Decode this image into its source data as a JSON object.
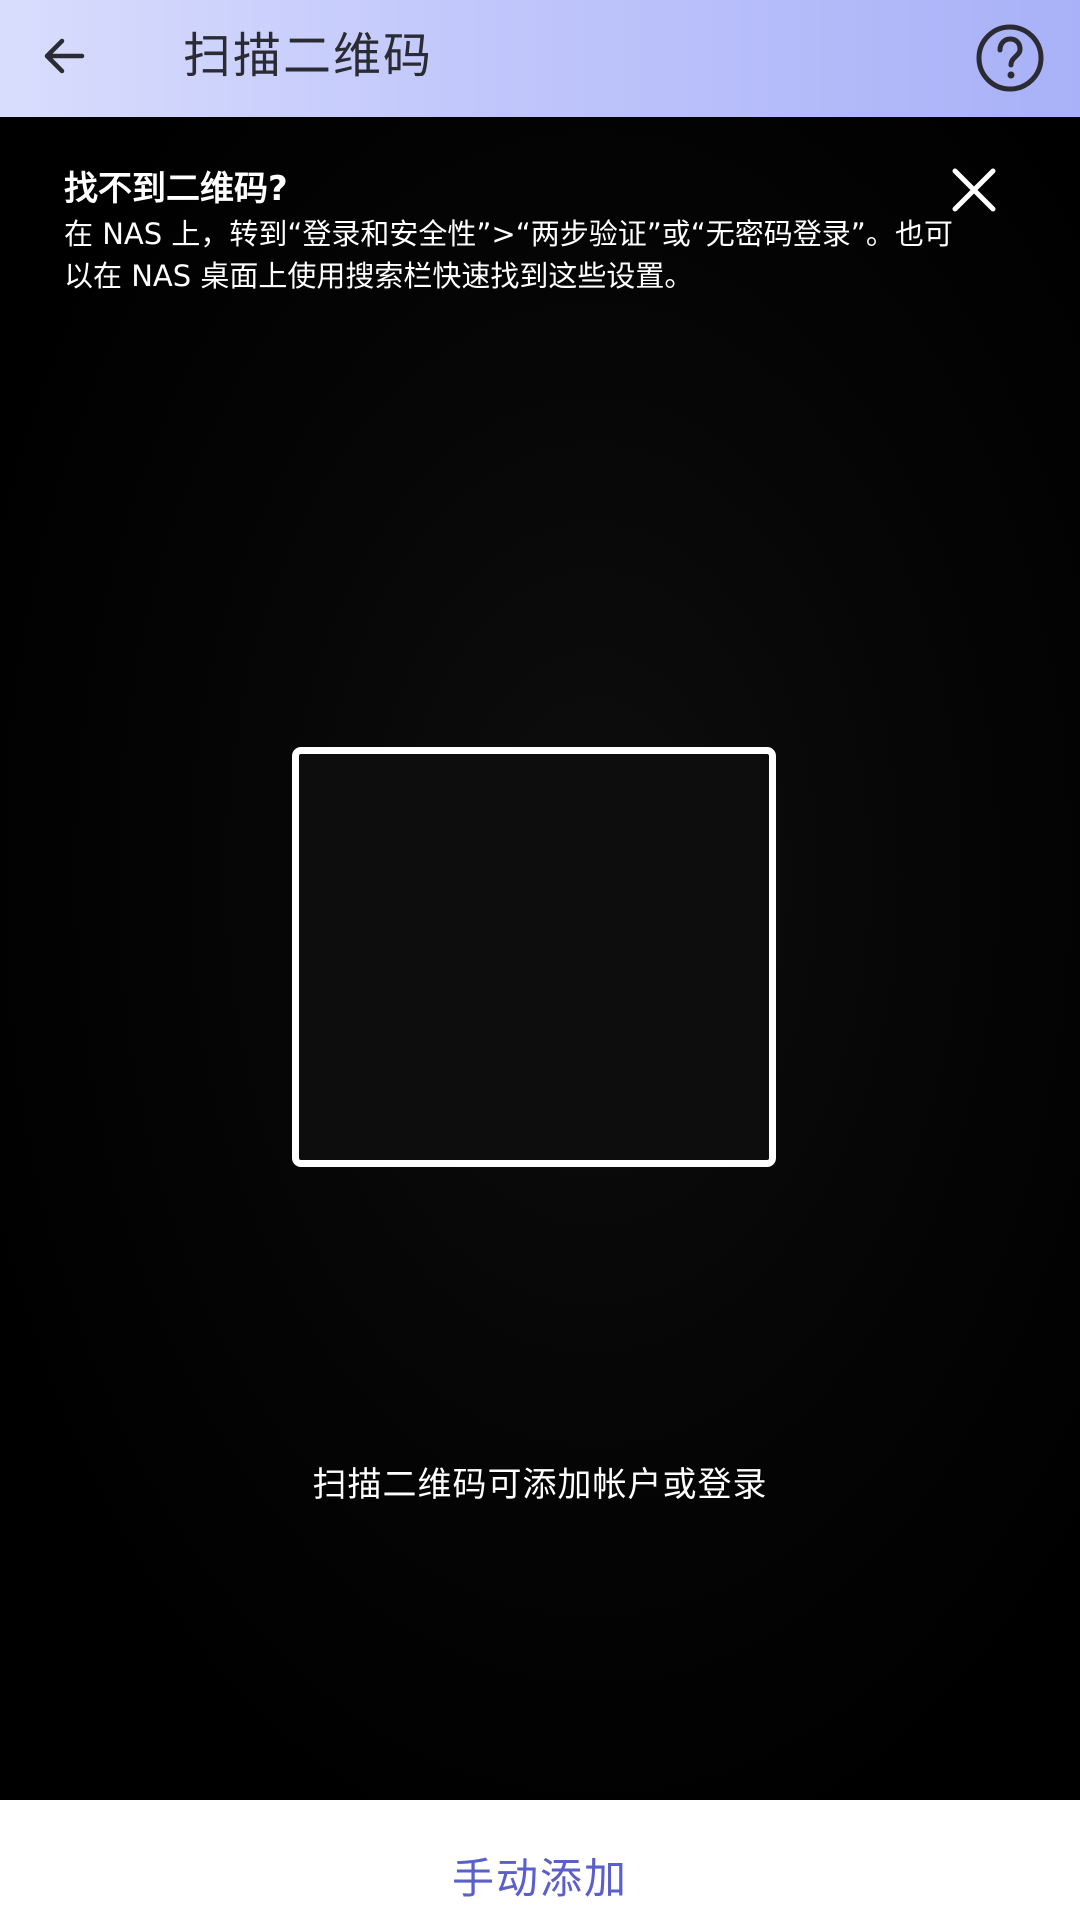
{
  "header": {
    "title": "扫描二维码",
    "back_icon": "arrow-left-icon",
    "help_icon": "question-circle-icon"
  },
  "hint": {
    "title": "找不到二维码?",
    "body": "在 NAS 上，转到“登录和安全性”>“两步验证”或“无密码登录”。也可以在 NAS 桌面上使用搜索栏快速找到这些设置。",
    "close_icon": "close-icon"
  },
  "scanner": {
    "caption": "扫描二维码可添加帐户或登录"
  },
  "footer": {
    "manual_add_label": "手动添加"
  },
  "colors": {
    "header_gradient_start": "#d9ddfd",
    "header_gradient_end": "#a9b1f8",
    "accent": "#5a5fc9",
    "camera_background": "#000000"
  }
}
